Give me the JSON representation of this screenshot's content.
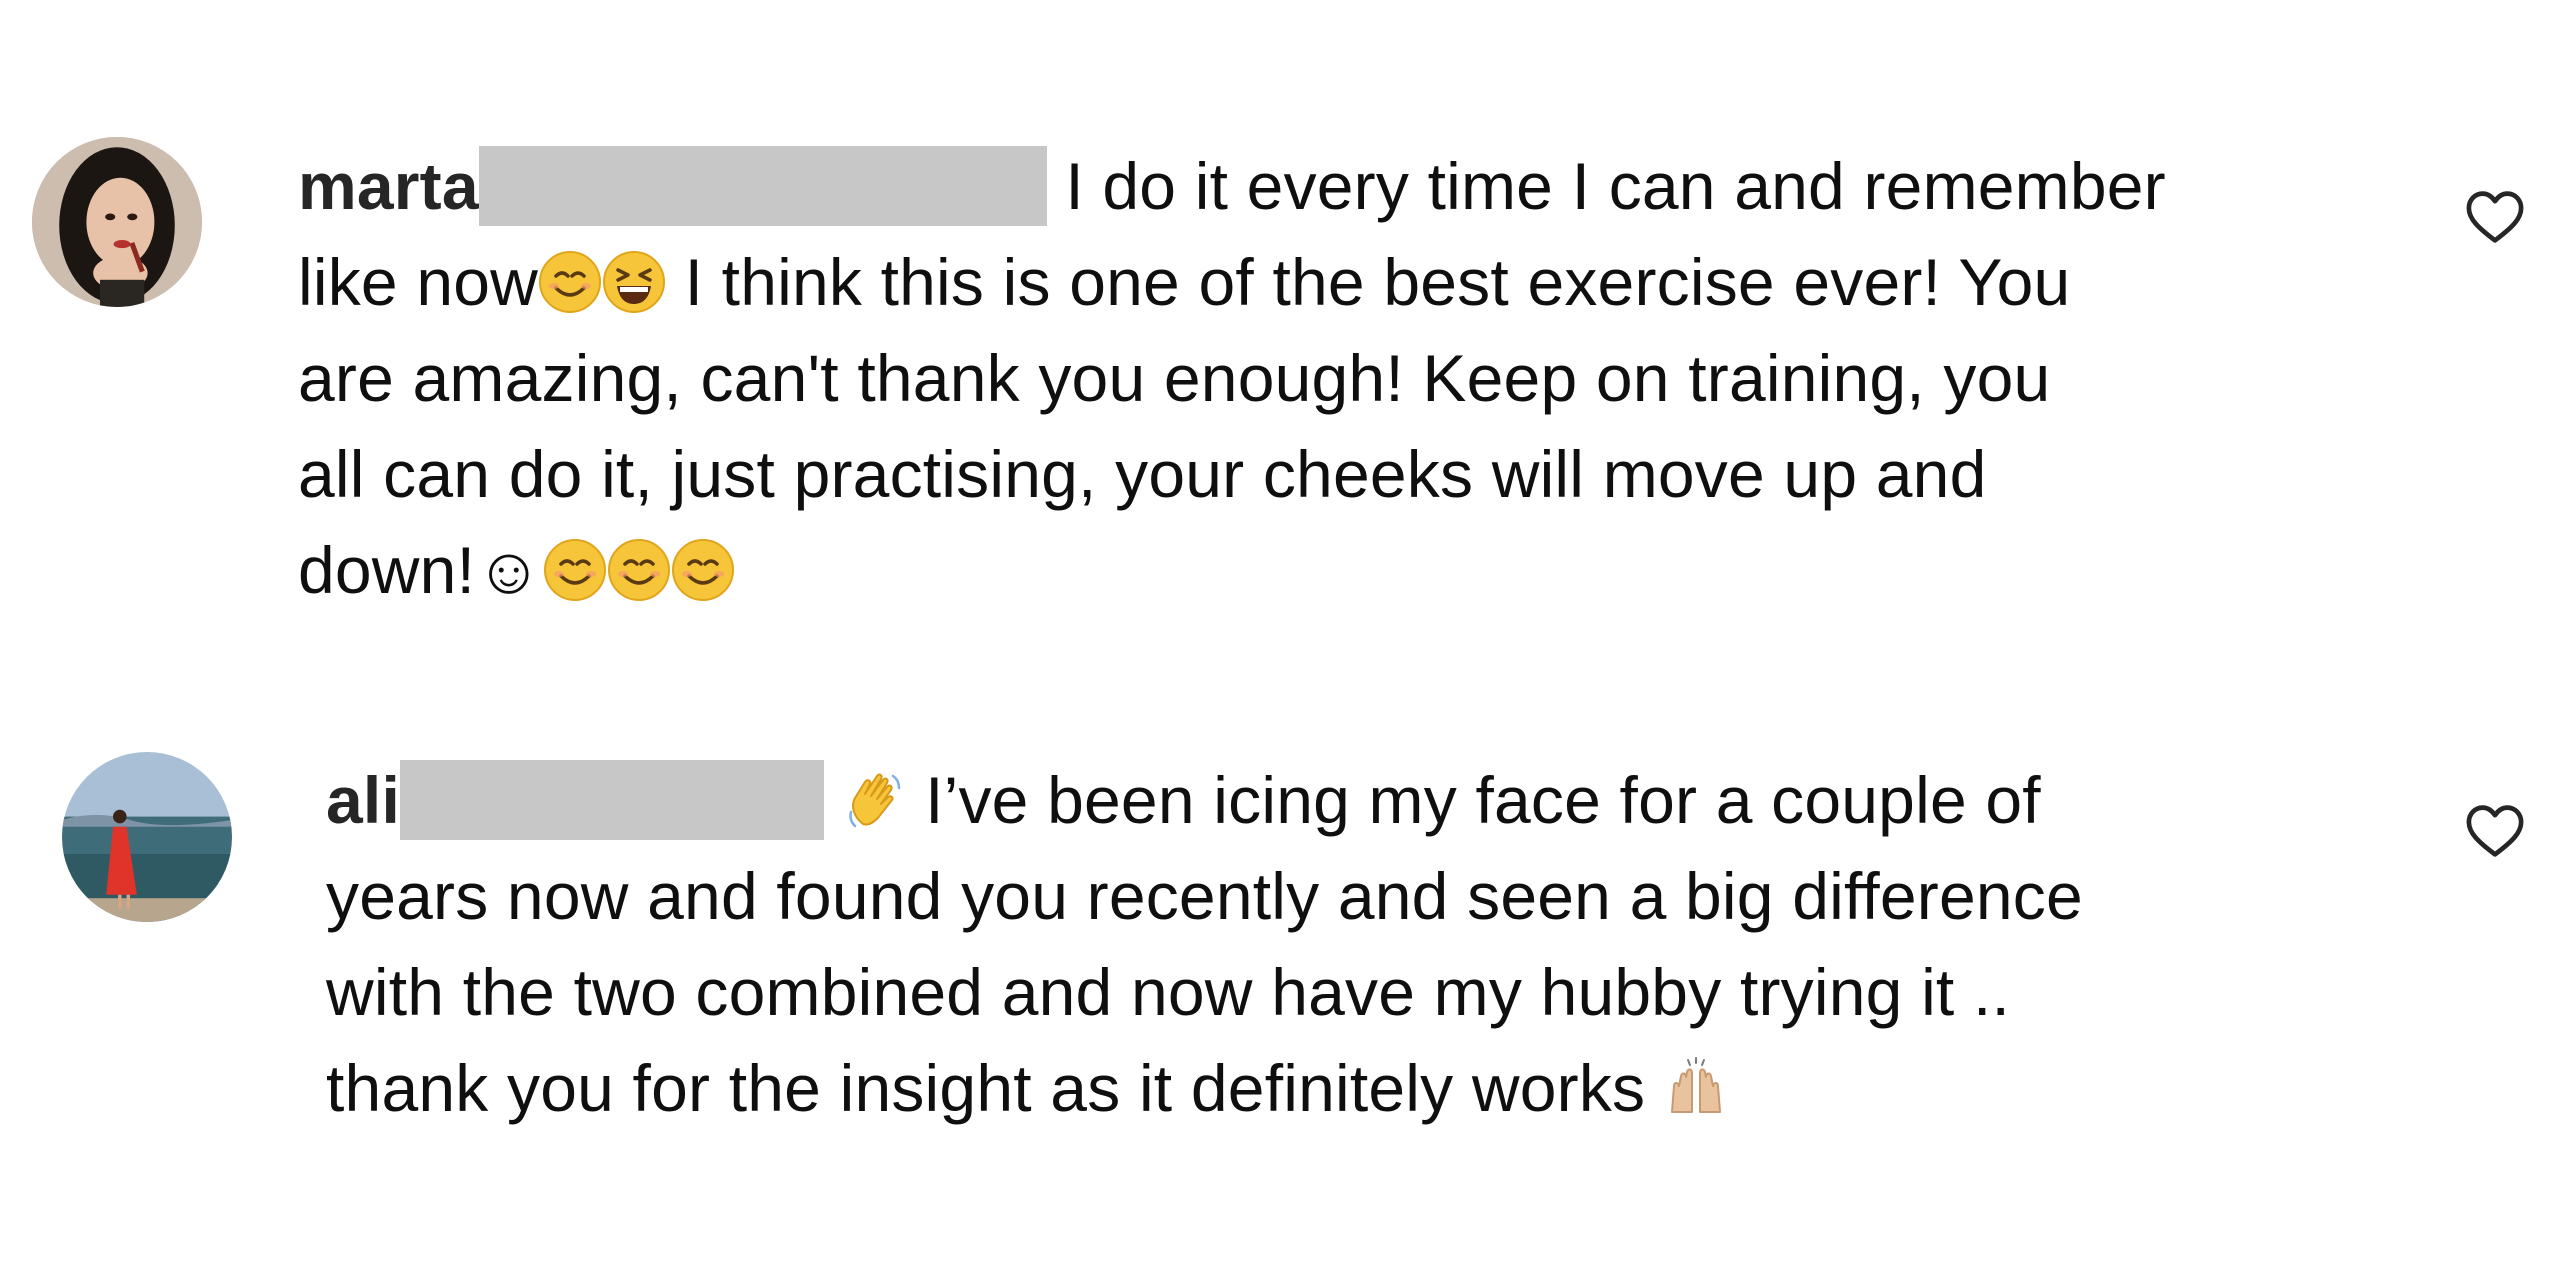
{
  "comments": [
    {
      "username": "marta",
      "text_line1": "I do it every time I can and remember",
      "text_line2a": "like now",
      "text_line2b": " I think this is one of the best exercise ever! You",
      "text_line3": "are amazing, can't thank you enough! Keep on training, you",
      "text_line4": "all can do it, just practising, your cheeks will move up and",
      "text_line5": "down!",
      "smiley_char": "☺",
      "avatar_icon": "avatar-photo-woman",
      "like_icon": "heart-outline-icon"
    },
    {
      "username": "ali",
      "text_line1": "I’ve been icing my face for a couple of",
      "text_line2": "years now and found you recently and seen a big difference",
      "text_line3": "with the two combined and now have my hubby trying it ..",
      "text_line4": "thank you for the insight as it definitely works",
      "avatar_icon": "avatar-photo-beach",
      "like_icon": "heart-outline-icon"
    }
  ],
  "colors": {
    "redaction": "#c7c7c7",
    "text": "#0f0f0f",
    "username": "#262626"
  }
}
